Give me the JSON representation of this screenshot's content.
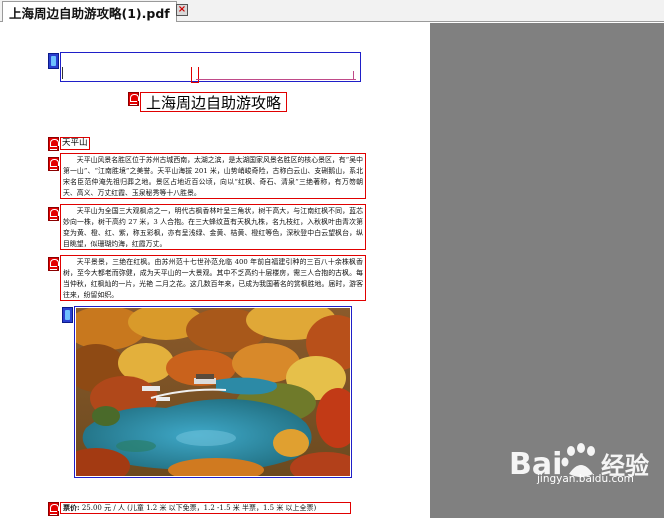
{
  "tab": {
    "title": "上海周边自助游攻略(1).pdf",
    "close_icon": "close-icon"
  },
  "document": {
    "title": "上海周边自助游攻略",
    "section_label": "天平山",
    "paragraphs": [
      "天平山风景名胜区位于苏州古城西南，太湖之滨，是太湖国家风景名胜区的核心景区，有“吴中第一山”、“江南胜境”之美誉。天平山海拔 201 米，山势峭峻奇险，古称白云山、支硎鹅山，系北宋名臣范仲淹先祖归葬之地。景区占地近百公顷，向以“红枫、奇石、清泉”三绝著称，有万笏朝天、高义、万丈红霞、玉泉秘秀等十八胜景。",
      "天平山为全国三大观枫点之一，明代古枫香林叶呈三角状，树干高大，与江南红枫不同，蓝芯妙向一株，树干高约 27 米，3 人合抱。在三大蜂纹苴有天枫九株，名九枝红，入秋枫叶由青次第变为黄、橙、红、紫，称五彩枫，亦有呈浅绿、金黄、桔黄、橙红等色，深秋登中白云望枫台，纵目眺望，似珊瑚灼海，红霞万丈。",
      "天平景景，三绝在红枫。由苏州范十七世孙范允临 400 年前自福建引种的三百八十余株枫香树，至今大都老而弥健，成为天平山的一大景观。其中不乏高约十层楼房，需三人合抱的古枫。每当仲秋，红枫灿的一片，光艳 二月之花。这几数百年来，已成为我国著名的赏枫胜地。届时，游客往来，纷留如织。"
    ],
    "price_label": "票价:",
    "price_text": "25.00 元 / 人 (儿童 1.2 米 以下免票，1.2 -1.5 米 半票，1.5 米 以上全票)"
  },
  "watermark": {
    "brand": "Bai 经验",
    "url": "jingyan.baidu.com"
  },
  "colors": {
    "annotation_red": "#e30000",
    "annotation_blue": "#1f1fc8",
    "viewer_gray": "#808080"
  }
}
